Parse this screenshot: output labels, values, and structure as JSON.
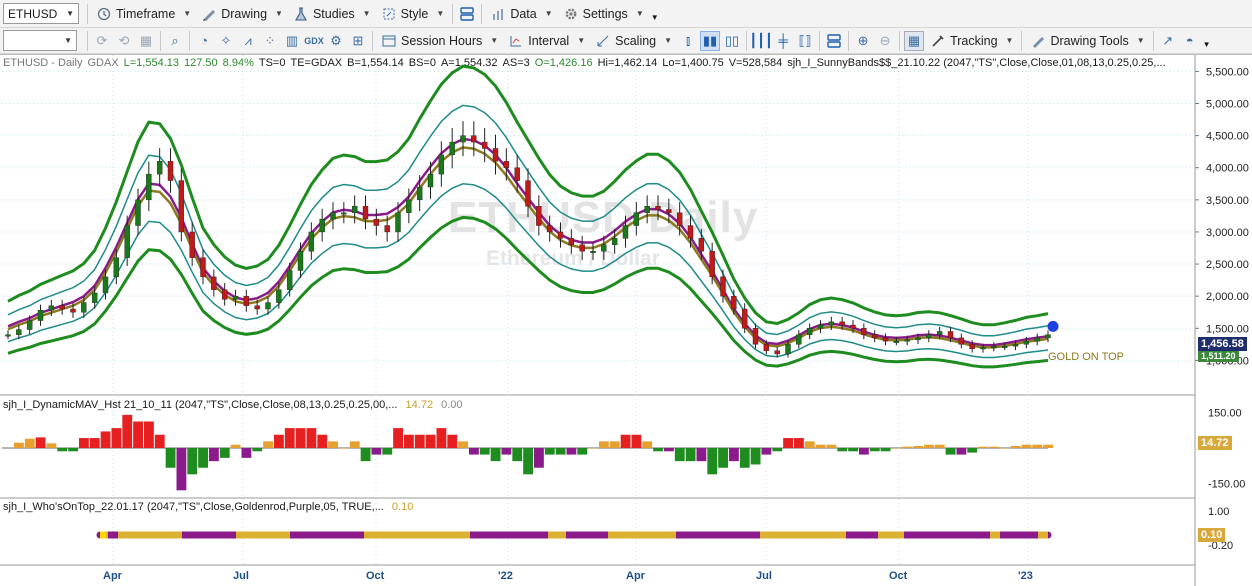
{
  "toolbar1": {
    "symbol": "ETHUSD",
    "timeframe": "Timeframe",
    "drawing": "Drawing",
    "studies": "Studies",
    "style": "Style",
    "data": "Data",
    "settings": "Settings"
  },
  "toolbar2": {
    "combo_value": "",
    "session_hours": "Session Hours",
    "interval": "Interval",
    "scaling": "Scaling",
    "tracking": "Tracking",
    "drawing_tools": "Drawing Tools"
  },
  "info": {
    "symbol": "ETHUSD - Daily",
    "exchange": "GDAX",
    "last": "L=1,554.13",
    "change": "127.50",
    "pct": "8.94%",
    "ts": "TS=0",
    "te": "TE=GDAX",
    "bid": "B=1,554.14",
    "bs": "BS=0",
    "ask": "A=1,554.32",
    "as": "AS=3",
    "open": "O=1,426.16",
    "hi": "Hi=1,462.14",
    "lo": "Lo=1,400.75",
    "vol": "V=528,584",
    "study": "sjh_I_SunnyBands$$_21.10.22 (2047,\"TS\",Close,Close,01,08,13,0.25,0.25,..."
  },
  "watermark": {
    "title": "ETHUSD Daily",
    "subtitle": "Ethereum / Dollar"
  },
  "panel2": {
    "label": "sjh_I_DynamicMAV_Hst 21_10_11 (2047,\"TS\",Close,Close,08,13,0.25,0.25,00,...",
    "v1": "14.72",
    "v2": "0.00",
    "tag": "14.72"
  },
  "panel3": {
    "label": "sjh_I_Who'sOnTop_22.01.17 (2047,\"TS\",Close,Goldenrod,Purple,05, TRUE,...",
    "v1": "0.10",
    "tag": "0.10"
  },
  "price_tag": "1,456.58",
  "price_tag2": "1,511.20",
  "gold_note": "GOLD ON TOP",
  "colors": {
    "green": "#1e8c1e",
    "teal": "#1f8b8b",
    "purple": "#8b1a8b",
    "olive": "#8b7a1f",
    "red": "#e62020",
    "orange": "#e6a030",
    "gold": "#dcb030",
    "price_tag_bg": "#1e2d6b",
    "gold_tag_bg": "#d9a83a"
  },
  "icons": [
    "pin-icon",
    "timeframe-icon",
    "drawing-icon",
    "studies-icon",
    "style-icon",
    "layout-icon",
    "data-icon",
    "settings-icon",
    "zoom-in-icon",
    "zoom-out-icon",
    "tracking-icon",
    "drawing-tools-icon"
  ],
  "chart_data": {
    "type": "line",
    "title": "ETHUSD - Daily",
    "x_ticks": [
      "Apr",
      "Jul",
      "Oct",
      "'22",
      "Apr",
      "Jul",
      "Oct",
      "'23"
    ],
    "y_ticks": [
      "5,500.00",
      "5,000.00",
      "4,500.00",
      "4,000.00",
      "3,500.00",
      "3,000.00",
      "2,500.00",
      "2,000.00",
      "1,500.00",
      "1,000.00"
    ],
    "ylim": [
      850,
      5600
    ],
    "series": [
      {
        "values": [
          1400,
          1480,
          1620,
          1780,
          1850,
          1800,
          1750,
          1900,
          2050,
          2300,
          2600,
          3100,
          3500,
          3900,
          4100,
          3800,
          3000,
          2600,
          2300,
          2100,
          1950,
          2000,
          1850,
          1800,
          1900,
          2100,
          2400,
          2700,
          3000,
          3200,
          3300,
          3300,
          3400,
          3200,
          3100,
          3000,
          3300,
          3500,
          3700,
          3900,
          4200,
          4400,
          4500,
          4400,
          4300,
          4100,
          4000,
          3800,
          3400,
          3100,
          3000,
          2900,
          2800,
          2700,
          2700,
          2800,
          2900,
          3100,
          3300,
          3400,
          3350,
          3300,
          3100,
          2900,
          2700,
          2300,
          2000,
          1800,
          1500,
          1250,
          1150,
          1100,
          1250,
          1400,
          1500,
          1550,
          1600,
          1550,
          1500,
          1400,
          1350,
          1300,
          1300,
          1320,
          1350,
          1400,
          1450,
          1350,
          1250,
          1180,
          1200,
          1220,
          1220,
          1250,
          1300,
          1350,
          1400
        ]
      }
    ],
    "panel2": {
      "y_ticks": [
        "150.00",
        "0.00",
        "-150.00"
      ],
      "ylim": [
        -200,
        190
      ]
    },
    "panel3": {
      "y_ticks": [
        "1.00",
        "0.10",
        "-0.20"
      ]
    }
  }
}
